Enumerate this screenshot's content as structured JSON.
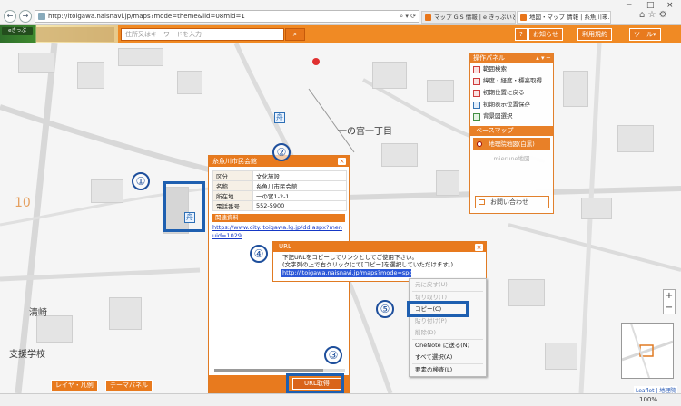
{
  "browser": {
    "address": "http://itoigawa.naisnavi.jp/maps?mode=theme&lid=08mid=1",
    "tabs": [
      "マップ GIS 情報 | e きっぷいとい...",
      "地図・マップ 情報 | 糸魚川市..."
    ],
    "nav_back": "←",
    "nav_forward": "→",
    "tab_close": "×",
    "tools": "⌂ ☆ ⚙",
    "window_controls": [
      "─",
      "□",
      "×"
    ],
    "addr_tools": "⌕ ▾ ⟳"
  },
  "header": {
    "logo_text": "eきっぷ",
    "search_placeholder": "住所又はキーワードを入力",
    "search_button": "⌕",
    "buttons": [
      "?",
      "お知らせ",
      "利用規約",
      "ツール▾"
    ]
  },
  "map": {
    "labels": [
      "一の宮一丁目",
      "10",
      "清崎",
      "支援学校"
    ],
    "facility_icon": "舟"
  },
  "control_panel": {
    "title": "操作パネル",
    "title_ctl": "▴ ▾ ─",
    "items": [
      "範囲検索",
      "緯度・経度・標高取得",
      "初期位置に戻る",
      "初期表示位置保存",
      "背景図選択"
    ],
    "base_map_title": "ベースマップ",
    "base_selected": "地理院地図(白黒)",
    "base_other": "mierune地図",
    "contact_label": "お問い合わせ"
  },
  "facility_popup": {
    "title": "糸魚川市民会館",
    "close": "×",
    "rows": [
      {
        "key": "区分",
        "value": "文化施設"
      },
      {
        "key": "名称",
        "value": "糸魚川市民会館"
      },
      {
        "key": "所在地",
        "value": "一の宮1-2-1"
      },
      {
        "key": "電話番号",
        "value": "552-5900"
      }
    ],
    "related_label": "関連資料",
    "link": "https://www.city.itoigawa.lg.jp/dd.aspx?menuid=1029",
    "url_button": "URL取得"
  },
  "url_dialog": {
    "title": "URL",
    "close": "×",
    "message_1": "下記URLをコピーしてリンクとしてご使用下さい。",
    "message_2": "(文字列の上で右クリックにて[コピー]を選択していただけます。)",
    "url": "http://itoigawa.naisnavi.jp/maps?mode=spot&l"
  },
  "context_menu": {
    "items": [
      {
        "label": "元に戻す(U)",
        "enabled": false
      },
      {
        "label": "切り取り(T)",
        "enabled": false
      },
      {
        "label": "コピー(C)",
        "enabled": true
      },
      {
        "label": "貼り付け(P)",
        "enabled": false
      },
      {
        "label": "削除(D)",
        "enabled": false
      },
      {
        "label": "OneNote に送る(N)",
        "enabled": true
      },
      {
        "label": "すべて選択(A)",
        "enabled": true
      },
      {
        "label": "要素の検査(L)",
        "enabled": true
      }
    ]
  },
  "annotations": [
    "①",
    "②",
    "③",
    "④",
    "⑤"
  ],
  "footer": {
    "layer_button": "レイヤ・凡例",
    "theme_button": "テーマパネル",
    "zoom_level": "100%",
    "attribution": "Leaflet | 地理院",
    "zoom_in": "+",
    "zoom_out": "−"
  }
}
